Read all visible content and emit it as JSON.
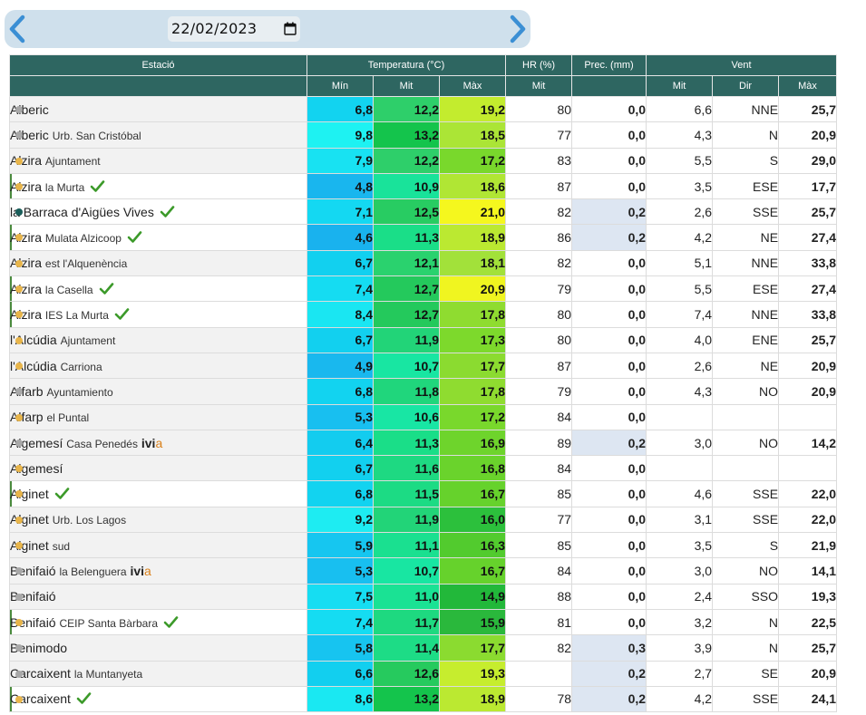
{
  "date_value": "22/02/2023",
  "colors": {
    "header_bg": "#2e6661",
    "dot_yellow": "#e8b54a",
    "dot_gray": "#a8a8a8",
    "dot_teal": "#1a5e5a",
    "check_green": "#3c9a2a",
    "ivia_orange": "#d9801a",
    "prec_wet": "#dde6f2"
  },
  "icons": {
    "prev": "chevron-left-icon",
    "next": "chevron-right-icon",
    "calendar": "calendar-icon",
    "check": "checkmark-icon"
  },
  "headers": {
    "station": "Estació",
    "temperature": "Temperatura (°C)",
    "humidity": "HR (%)",
    "precipitation": "Prec. (mm)",
    "wind": "Vent",
    "t_min": "Mín",
    "t_avg": "Mit",
    "t_max": "Màx",
    "hr_avg": "Mit",
    "w_avg": "Mit",
    "w_dir": "Dir",
    "w_max": "Màx"
  },
  "rows": [
    {
      "name": "Alberic",
      "loc": "",
      "dot": "gray",
      "check": false,
      "ivia": false,
      "mark": false,
      "gray": true,
      "tmin": "6,8",
      "tavg": "12,2",
      "tmax": "19,2",
      "hr": "80",
      "prec": "0,0",
      "wavg": "6,6",
      "wdir": "NNE",
      "wmax": "25,7",
      "cmin": "#12d3f0",
      "cavg": "#2ecf6a",
      "cmax": "#c3ec2e",
      "wet": false
    },
    {
      "name": "Alberic",
      "loc": "Urb. San Cristóbal",
      "dot": "gray",
      "check": false,
      "ivia": false,
      "mark": false,
      "gray": true,
      "tmin": "9,8",
      "tavg": "13,2",
      "tmax": "18,5",
      "hr": "77",
      "prec": "0,0",
      "wavg": "4,3",
      "wdir": "N",
      "wmax": "20,9",
      "cmin": "#1ef2f2",
      "cavg": "#14c44c",
      "cmax": "#abe536",
      "wet": false
    },
    {
      "name": "Alzira",
      "loc": "Ajuntament",
      "dot": "yellow",
      "check": false,
      "ivia": false,
      "mark": false,
      "gray": true,
      "tmin": "7,9",
      "tavg": "12,2",
      "tmax": "17,2",
      "hr": "83",
      "prec": "0,0",
      "wavg": "5,5",
      "wdir": "S",
      "wmax": "29,0",
      "cmin": "#18e2f2",
      "cavg": "#2ecf6a",
      "cmax": "#79d82c",
      "wet": false
    },
    {
      "name": "Alzira",
      "loc": "la Murta",
      "dot": "yellow",
      "check": true,
      "ivia": false,
      "mark": true,
      "gray": false,
      "tmin": "4,8",
      "tavg": "10,9",
      "tmax": "18,6",
      "hr": "87",
      "prec": "0,0",
      "wavg": "3,5",
      "wdir": "ESE",
      "wmax": "17,7",
      "cmin": "#19b6ee",
      "cavg": "#19e39a",
      "cmax": "#b0e634",
      "wet": false
    },
    {
      "name": "la Barraca d'Aigües Vives",
      "loc": "",
      "dot": "teal",
      "check": true,
      "ivia": false,
      "mark": false,
      "gray": false,
      "tmin": "7,1",
      "tavg": "12,5",
      "tmax": "21,0",
      "hr": "82",
      "prec": "0,2",
      "wavg": "2,6",
      "wdir": "SSE",
      "wmax": "25,7",
      "cmin": "#14d8f2",
      "cavg": "#28cc62",
      "cmax": "#f5f71e",
      "wet": true
    },
    {
      "name": "Alzira",
      "loc": "Mulata Alzicoop",
      "dot": "yellow",
      "check": true,
      "ivia": false,
      "mark": true,
      "gray": false,
      "tmin": "4,6",
      "tavg": "11,3",
      "tmax": "18,9",
      "hr": "86",
      "prec": "0,2",
      "wavg": "4,2",
      "wdir": "NE",
      "wmax": "27,4",
      "cmin": "#19b2ee",
      "cavg": "#1ade88",
      "cmax": "#bbe931",
      "wet": true
    },
    {
      "name": "Alzira",
      "loc": "est l'Alquenència",
      "dot": "yellow",
      "check": false,
      "ivia": false,
      "mark": false,
      "gray": true,
      "tmin": "6,7",
      "tavg": "12,1",
      "tmax": "18,1",
      "hr": "82",
      "prec": "0,0",
      "wavg": "5,1",
      "wdir": "NNE",
      "wmax": "33,8",
      "cmin": "#12d0ef",
      "cavg": "#2ad26e",
      "cmax": "#a2e13a",
      "wet": false
    },
    {
      "name": "Alzira",
      "loc": "la Casella",
      "dot": "yellow",
      "check": true,
      "ivia": false,
      "mark": true,
      "gray": false,
      "tmin": "7,4",
      "tavg": "12,7",
      "tmax": "20,9",
      "hr": "79",
      "prec": "0,0",
      "wavg": "5,5",
      "wdir": "ESE",
      "wmax": "27,4",
      "cmin": "#15dcf2",
      "cavg": "#24c95c",
      "cmax": "#f0f520",
      "wet": false
    },
    {
      "name": "Alzira",
      "loc": "IES La Murta",
      "dot": "yellow",
      "check": true,
      "ivia": false,
      "mark": true,
      "gray": false,
      "tmin": "8,4",
      "tavg": "12,7",
      "tmax": "17,8",
      "hr": "80",
      "prec": "0,0",
      "wavg": "7,4",
      "wdir": "NNE",
      "wmax": "33,8",
      "cmin": "#1ae6f2",
      "cavg": "#24c95c",
      "cmax": "#8fdc30",
      "wet": false
    },
    {
      "name": "l'Alcúdia",
      "loc": "Ajuntament",
      "dot": "yellow",
      "check": false,
      "ivia": false,
      "mark": false,
      "gray": true,
      "tmin": "6,7",
      "tavg": "11,9",
      "tmax": "17,3",
      "hr": "80",
      "prec": "0,0",
      "wavg": "4,0",
      "wdir": "ENE",
      "wmax": "25,7",
      "cmin": "#12d0ef",
      "cavg": "#22d478",
      "cmax": "#7dd92c",
      "wet": false
    },
    {
      "name": "l'Alcúdia",
      "loc": "Carriona",
      "dot": "yellow",
      "check": false,
      "ivia": false,
      "mark": false,
      "gray": true,
      "tmin": "4,9",
      "tavg": "10,7",
      "tmax": "17,7",
      "hr": "87",
      "prec": "0,0",
      "wavg": "2,6",
      "wdir": "NE",
      "wmax": "20,9",
      "cmin": "#19b8ee",
      "cavg": "#18e6a2",
      "cmax": "#8bdb30",
      "wet": false
    },
    {
      "name": "Alfarb",
      "loc": "Ayuntamiento",
      "dot": "gray",
      "check": false,
      "ivia": false,
      "mark": false,
      "gray": true,
      "tmin": "6,8",
      "tavg": "11,8",
      "tmax": "17,8",
      "hr": "79",
      "prec": "0,0",
      "wavg": "4,3",
      "wdir": "NO",
      "wmax": "20,9",
      "cmin": "#12d3f0",
      "cavg": "#20d67c",
      "cmax": "#8fdc30",
      "wet": false
    },
    {
      "name": "Alfarp",
      "loc": "el Puntal",
      "dot": "yellow",
      "check": false,
      "ivia": false,
      "mark": false,
      "gray": true,
      "tmin": "5,3",
      "tavg": "10,6",
      "tmax": "17,2",
      "hr": "84",
      "prec": "0,0",
      "wavg": "",
      "wdir": "",
      "wmax": "",
      "cmin": "#18bff0",
      "cavg": "#18e6a4",
      "cmax": "#79d82c",
      "wet": false
    },
    {
      "name": "Algemesí",
      "loc": "Casa Penedés",
      "dot": "gray",
      "check": false,
      "ivia": true,
      "mark": false,
      "gray": true,
      "tmin": "6,4",
      "tavg": "11,3",
      "tmax": "16,9",
      "hr": "89",
      "prec": "0,2",
      "wavg": "3,0",
      "wdir": "NO",
      "wmax": "14,2",
      "cmin": "#13ccef",
      "cavg": "#1ade88",
      "cmax": "#6ed42c",
      "wet": true
    },
    {
      "name": "Algemesí",
      "loc": "",
      "dot": "yellow",
      "check": false,
      "ivia": false,
      "mark": false,
      "gray": true,
      "tmin": "6,7",
      "tavg": "11,6",
      "tmax": "16,8",
      "hr": "84",
      "prec": "0,0",
      "wavg": "",
      "wdir": "",
      "wmax": "",
      "cmin": "#12d0ef",
      "cavg": "#1ed982",
      "cmax": "#6ad32c",
      "wet": false
    },
    {
      "name": "Alginet",
      "loc": "",
      "dot": "yellow",
      "check": true,
      "ivia": false,
      "mark": true,
      "gray": false,
      "tmin": "6,8",
      "tavg": "11,5",
      "tmax": "16,7",
      "hr": "85",
      "prec": "0,0",
      "wavg": "4,6",
      "wdir": "SSE",
      "wmax": "22,0",
      "cmin": "#12d3f0",
      "cavg": "#1cdb84",
      "cmax": "#66d22c",
      "wet": false
    },
    {
      "name": "Alginet",
      "loc": "Urb. Los Lagos",
      "dot": "yellow",
      "check": false,
      "ivia": false,
      "mark": false,
      "gray": true,
      "tmin": "9,2",
      "tavg": "11,9",
      "tmax": "16,0",
      "hr": "77",
      "prec": "0,0",
      "wavg": "3,1",
      "wdir": "SSE",
      "wmax": "22,0",
      "cmin": "#1eecf2",
      "cavg": "#22d478",
      "cmax": "#2cc03c",
      "wet": false
    },
    {
      "name": "Alginet",
      "loc": "sud",
      "dot": "yellow",
      "check": false,
      "ivia": false,
      "mark": false,
      "gray": true,
      "tmin": "5,9",
      "tavg": "11,1",
      "tmax": "16,3",
      "hr": "85",
      "prec": "0,0",
      "wavg": "3,5",
      "wdir": "S",
      "wmax": "21,9",
      "cmin": "#16c6f0",
      "cavg": "#1ae090",
      "cmax": "#52cb2e",
      "wet": false
    },
    {
      "name": "Benifaió",
      "loc": "la Belenguera",
      "dot": "gray",
      "check": false,
      "ivia": true,
      "mark": false,
      "gray": true,
      "tmin": "5,3",
      "tavg": "10,7",
      "tmax": "16,7",
      "hr": "84",
      "prec": "0,0",
      "wavg": "3,0",
      "wdir": "NO",
      "wmax": "14,1",
      "cmin": "#18bff0",
      "cavg": "#18e6a2",
      "cmax": "#66d22c",
      "wet": false
    },
    {
      "name": "Benifaió",
      "loc": "",
      "dot": "gray",
      "check": false,
      "ivia": false,
      "mark": false,
      "gray": true,
      "tmin": "7,5",
      "tavg": "11,0",
      "tmax": "14,9",
      "hr": "88",
      "prec": "0,0",
      "wavg": "2,4",
      "wdir": "SSO",
      "wmax": "19,3",
      "cmin": "#16ddf2",
      "cavg": "#1ae294",
      "cmax": "#22b83a",
      "wet": false
    },
    {
      "name": "Benifaió",
      "loc": "CEIP Santa Bàrbara",
      "dot": "yellow",
      "check": true,
      "ivia": false,
      "mark": true,
      "gray": false,
      "tmin": "7,4",
      "tavg": "11,7",
      "tmax": "15,9",
      "hr": "81",
      "prec": "0,0",
      "wavg": "3,2",
      "wdir": "N",
      "wmax": "22,5",
      "cmin": "#15dcf2",
      "cavg": "#1ed980",
      "cmax": "#2ab83c",
      "wet": false
    },
    {
      "name": "Benimodo",
      "loc": "",
      "dot": "gray",
      "check": false,
      "ivia": false,
      "mark": false,
      "gray": true,
      "tmin": "5,8",
      "tavg": "11,4",
      "tmax": "17,7",
      "hr": "82",
      "prec": "0,3",
      "wavg": "3,9",
      "wdir": "N",
      "wmax": "25,7",
      "cmin": "#17c4f0",
      "cavg": "#1ddc86",
      "cmax": "#8bdb30",
      "wet": true
    },
    {
      "name": "Carcaixent",
      "loc": "la Muntanyeta",
      "dot": "gray",
      "check": false,
      "ivia": false,
      "mark": false,
      "gray": true,
      "tmin": "6,6",
      "tavg": "12,6",
      "tmax": "19,3",
      "hr": "",
      "prec": "0,2",
      "wavg": "2,7",
      "wdir": "SE",
      "wmax": "20,9",
      "cmin": "#12cfef",
      "cavg": "#26ca5e",
      "cmax": "#c6ed2e",
      "wet": true
    },
    {
      "name": "Carcaixent",
      "loc": "",
      "dot": "yellow",
      "check": true,
      "ivia": false,
      "mark": true,
      "gray": false,
      "tmin": "8,6",
      "tavg": "13,2",
      "tmax": "18,9",
      "hr": "78",
      "prec": "0,2",
      "wavg": "4,2",
      "wdir": "SSE",
      "wmax": "24,1",
      "cmin": "#1ae8f2",
      "cavg": "#14c44c",
      "cmax": "#bbe931",
      "wet": true
    }
  ]
}
